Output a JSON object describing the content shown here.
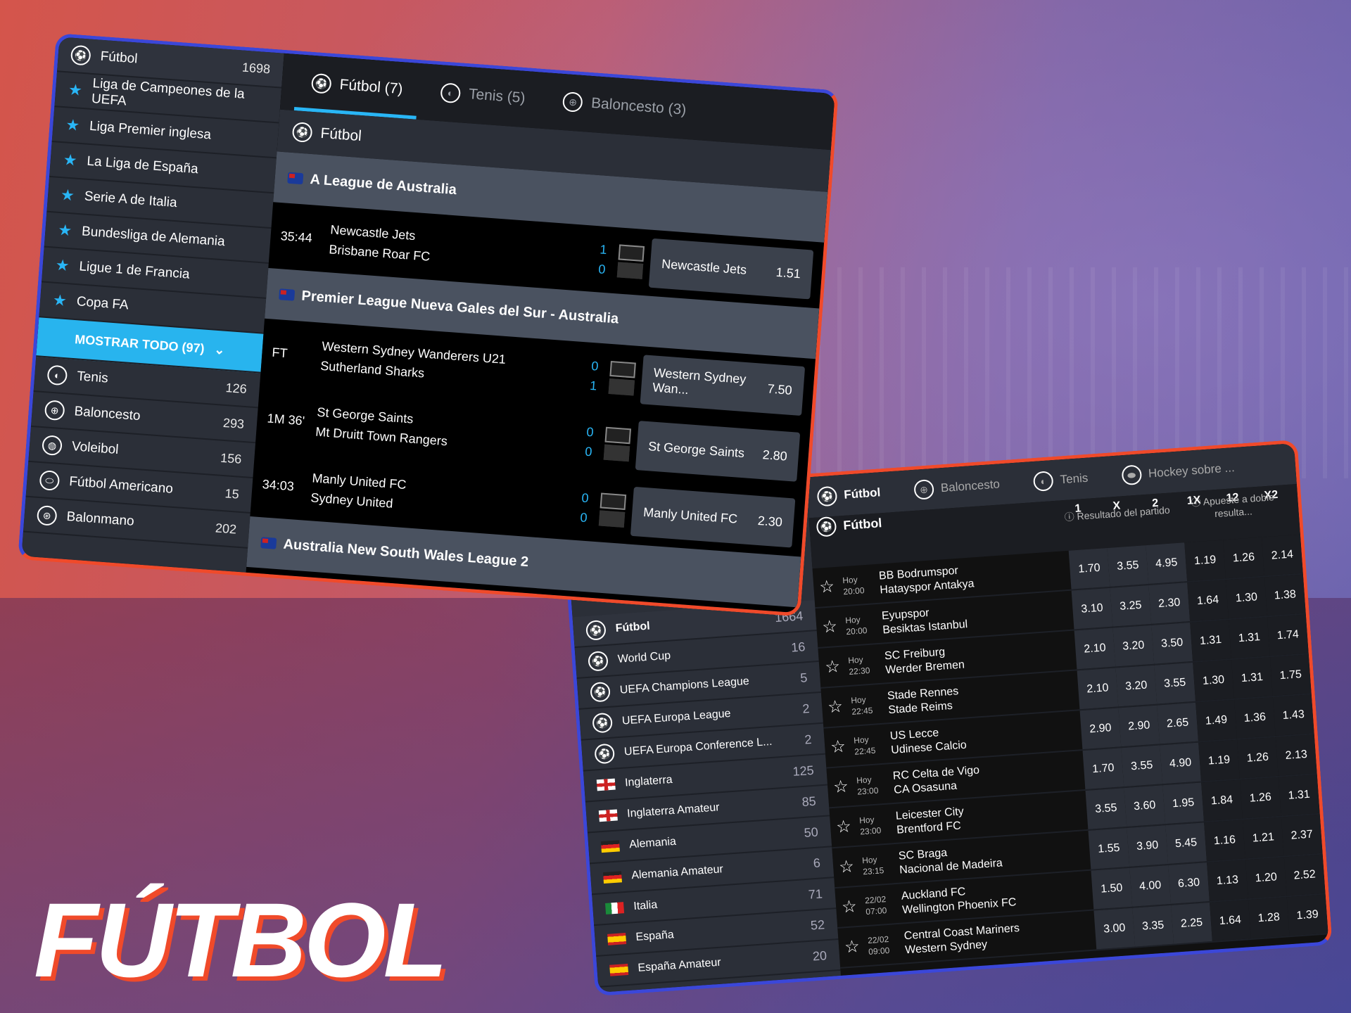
{
  "title": "FÚTBOL",
  "colors": {
    "accent": "#29b6f6",
    "frame_red": "#f04a2a",
    "frame_blue": "#3b47d9"
  },
  "panel1": {
    "sidebar": {
      "header": {
        "label": "Fútbol",
        "count": "1698",
        "icon": "soccer-ball-icon"
      },
      "leagues": [
        "Liga de Campeones de la UEFA",
        "Liga Premier inglesa",
        "La Liga de España",
        "Serie A de Italia",
        "Bundesliga de Alemania",
        "Ligue 1 de Francia",
        "Copa FA"
      ],
      "show_all": "MOSTRAR TODO (97)",
      "sports": [
        {
          "label": "Tenis",
          "count": "126",
          "icon": "tennis-ball-icon"
        },
        {
          "label": "Baloncesto",
          "count": "293",
          "icon": "basketball-icon"
        },
        {
          "label": "Voleibol",
          "count": "156",
          "icon": "volleyball-icon"
        },
        {
          "label": "Fútbol Americano",
          "count": "15",
          "icon": "american-football-icon"
        },
        {
          "label": "Balonmano",
          "count": "202",
          "icon": "handball-icon"
        }
      ]
    },
    "tabs": [
      {
        "label": "Fútbol (7)",
        "active": true
      },
      {
        "label": "Tenis (5)"
      },
      {
        "label": "Baloncesto (3)"
      }
    ],
    "subheader": "Fútbol",
    "groups": [
      {
        "league": "A League de Australia",
        "matches": [
          {
            "time": "35:44",
            "home": "Newcastle Jets",
            "away": "Brisbane Roar FC",
            "s1": "1",
            "s2": "0",
            "pick": "Newcastle Jets",
            "odd": "1.51"
          }
        ]
      },
      {
        "league": "Premier League Nueva Gales del Sur - Australia",
        "matches": [
          {
            "time": "FT",
            "home": "Western Sydney Wanderers U21",
            "away": "Sutherland Sharks",
            "s1": "0",
            "s2": "1",
            "pick": "Western Sydney Wan...",
            "odd": "7.50"
          },
          {
            "time": "1M 36'",
            "home": "St George Saints",
            "away": "Mt Druitt Town Rangers",
            "s1": "0",
            "s2": "0",
            "pick": "St George Saints",
            "odd": "2.80"
          },
          {
            "time": "34:03",
            "home": "Manly United FC",
            "away": "Sydney United",
            "s1": "0",
            "s2": "0",
            "pick": "Manly United FC",
            "odd": "2.30"
          }
        ]
      },
      {
        "league": "Australia New South Wales League 2",
        "matches": []
      }
    ]
  },
  "panel2": {
    "sidebar": {
      "header": {
        "label": "Fútbol",
        "count": "1664"
      },
      "items": [
        {
          "label": "World Cup",
          "count": "16",
          "icon": "soccer-ball-icon"
        },
        {
          "label": "UEFA Champions League",
          "count": "5",
          "icon": "soccer-ball-icon"
        },
        {
          "label": "UEFA Europa League",
          "count": "2",
          "icon": "soccer-ball-icon"
        },
        {
          "label": "UEFA Europa Conference L...",
          "count": "2",
          "icon": "soccer-ball-icon"
        },
        {
          "label": "Inglaterra",
          "count": "125",
          "icon": "flag-england-icon"
        },
        {
          "label": "Inglaterra Amateur",
          "count": "85",
          "icon": "flag-england-icon"
        },
        {
          "label": "Alemania",
          "count": "50",
          "icon": "flag-germany-icon"
        },
        {
          "label": "Alemania Amateur",
          "count": "6",
          "icon": "flag-germany-icon"
        },
        {
          "label": "Italia",
          "count": "71",
          "icon": "flag-italy-icon"
        },
        {
          "label": "España",
          "count": "52",
          "icon": "flag-spain-icon"
        },
        {
          "label": "España Amateur",
          "count": "20",
          "icon": "flag-spain-icon"
        }
      ]
    },
    "tabs": [
      {
        "label": "Fútbol",
        "active": true
      },
      {
        "label": "Baloncesto"
      },
      {
        "label": "Tenis"
      },
      {
        "label": "Hockey sobre ..."
      }
    ],
    "section": "Fútbol",
    "market1": "Resultado del partido",
    "market2": "Apueste a doble resulta...",
    "cols": [
      "1",
      "X",
      "2",
      "1X",
      "12",
      "X2"
    ],
    "rows": [
      {
        "day": "Hoy",
        "time": "20:00",
        "home": "BB Bodrumspor",
        "away": "Hatayspor Antakya",
        "odds": [
          "1.70",
          "3.55",
          "4.95",
          "1.19",
          "1.26",
          "2.14"
        ]
      },
      {
        "day": "Hoy",
        "time": "20:00",
        "home": "Eyupspor",
        "away": "Besiktas Istanbul",
        "odds": [
          "3.10",
          "3.25",
          "2.30",
          "1.64",
          "1.30",
          "1.38"
        ]
      },
      {
        "day": "Hoy",
        "time": "22:30",
        "home": "SC Freiburg",
        "away": "Werder Bremen",
        "odds": [
          "2.10",
          "3.20",
          "3.50",
          "1.31",
          "1.31",
          "1.74"
        ]
      },
      {
        "day": "Hoy",
        "time": "22:45",
        "home": "Stade Rennes",
        "away": "Stade Reims",
        "odds": [
          "2.10",
          "3.20",
          "3.55",
          "1.30",
          "1.31",
          "1.75"
        ]
      },
      {
        "day": "Hoy",
        "time": "22:45",
        "home": "US Lecce",
        "away": "Udinese Calcio",
        "odds": [
          "2.90",
          "2.90",
          "2.65",
          "1.49",
          "1.36",
          "1.43"
        ]
      },
      {
        "day": "Hoy",
        "time": "23:00",
        "home": "RC Celta de Vigo",
        "away": "CA Osasuna",
        "odds": [
          "1.70",
          "3.55",
          "4.90",
          "1.19",
          "1.26",
          "2.13"
        ]
      },
      {
        "day": "Hoy",
        "time": "23:00",
        "home": "Leicester City",
        "away": "Brentford FC",
        "odds": [
          "3.55",
          "3.60",
          "1.95",
          "1.84",
          "1.26",
          "1.31"
        ]
      },
      {
        "day": "Hoy",
        "time": "23:15",
        "home": "SC Braga",
        "away": "Nacional de Madeira",
        "odds": [
          "1.55",
          "3.90",
          "5.45",
          "1.16",
          "1.21",
          "2.37"
        ]
      },
      {
        "day": "22/02",
        "time": "07:00",
        "home": "Auckland FC",
        "away": "Wellington Phoenix FC",
        "odds": [
          "1.50",
          "4.00",
          "6.30",
          "1.13",
          "1.20",
          "2.52"
        ]
      },
      {
        "day": "22/02",
        "time": "09:00",
        "home": "Central Coast Mariners",
        "away": "Western Sydney",
        "odds": [
          "3.00",
          "3.35",
          "2.25",
          "1.64",
          "1.28",
          "1.39"
        ]
      }
    ]
  }
}
